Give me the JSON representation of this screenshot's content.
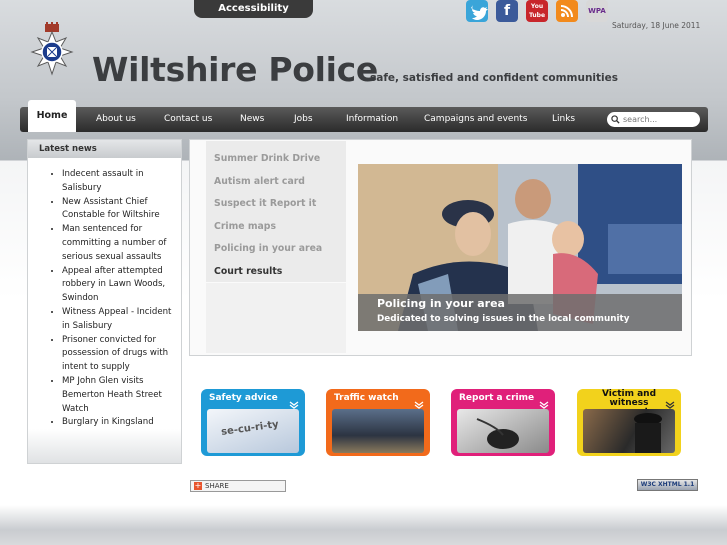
{
  "header": {
    "accessibility_label": "Accessibility",
    "date": "Saturday, 18 June 2011",
    "site_title": "Wiltshire Police",
    "tagline": "safe, satisfied and confident communities",
    "social_icons": [
      "twitter-icon",
      "facebook-icon",
      "youtube-icon",
      "rss-icon",
      "wpa-icon"
    ],
    "youtube_text": "You Tube",
    "facebook_text": "f",
    "wpa_text": "WPA"
  },
  "nav": {
    "items": [
      "Home",
      "About us",
      "Contact us",
      "News",
      "Jobs",
      "Information",
      "Campaigns and events",
      "Links"
    ],
    "search_placeholder": "search..."
  },
  "news": {
    "heading": "Latest news",
    "items": [
      "Indecent assault in Salisbury",
      "New Assistant Chief Constable for Wiltshire",
      "Man sentenced for committing a number of serious sexual assaults",
      "Appeal after attempted robbery in Lawn Woods, Swindon",
      "Witness Appeal - Incident in Salisbury",
      "Prisoner convicted for possession of drugs with intent to supply",
      "MP John Glen visits Bemerton Heath Street Watch",
      "Burglary in Kingsland Road, Salisbury"
    ]
  },
  "feature": {
    "menu": [
      "Summer Drink Drive",
      "Autism alert card",
      "Suspect it Report it",
      "Crime maps",
      "Policing in your area",
      "Court results"
    ],
    "active_index": 5,
    "caption_title": "Policing in your area",
    "caption_sub": "Dedicated to solving issues in the local community"
  },
  "tiles": [
    {
      "label": "Safety advice",
      "color": "#1e9ad6",
      "img_text": "se-cu-ri-ty"
    },
    {
      "label": "Traffic watch",
      "color": "#f26a1b"
    },
    {
      "label": "Report a crime",
      "color": "#e0207a"
    },
    {
      "label": "Victim and witness support",
      "color": "#f2d21c"
    }
  ],
  "footer": {
    "share_label": "SHARE",
    "w3c_label": "W3C XHTML 1.1"
  },
  "colors": {
    "nav_dark": "#2b2b2b",
    "accent_blue": "#1e9ad6"
  }
}
